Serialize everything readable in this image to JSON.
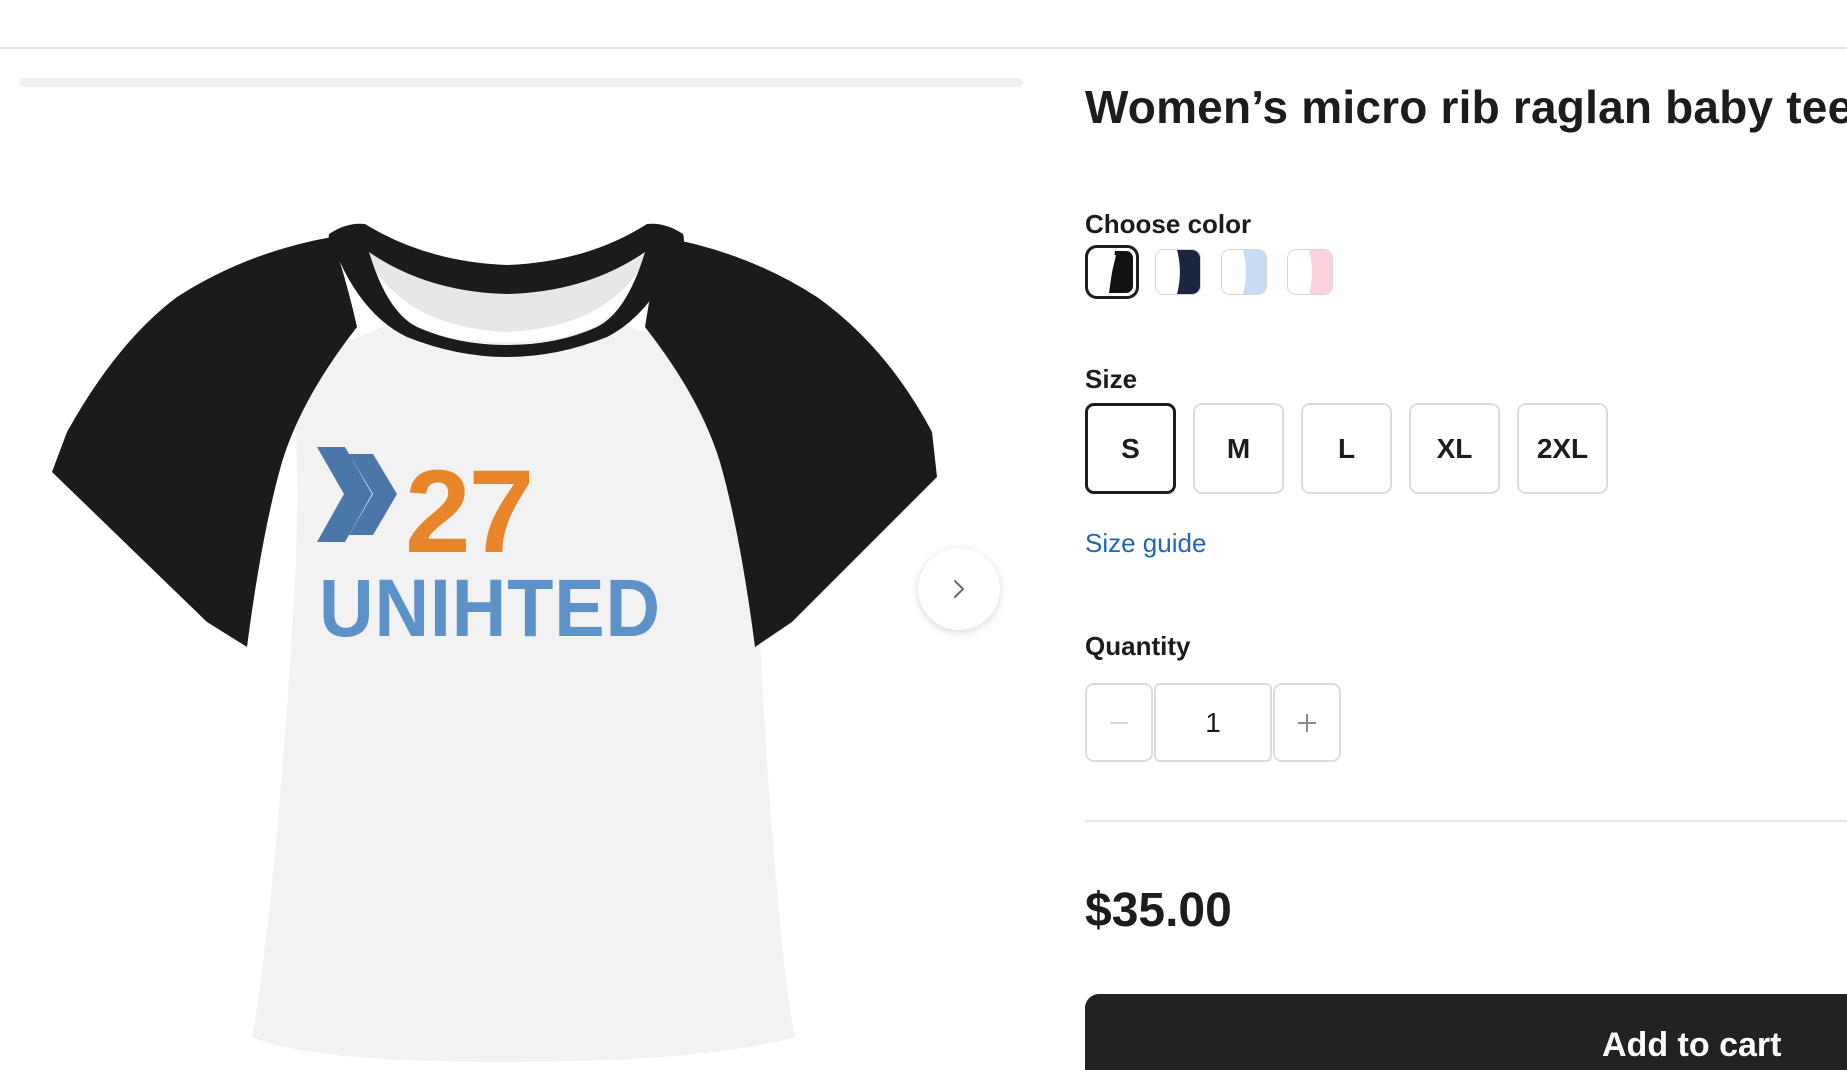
{
  "product": {
    "title": "Women’s micro rib raglan baby tee",
    "price": "$35.00",
    "image_print": {
      "number": "27",
      "word": "UNIHTED",
      "number_color": "#e8852b",
      "word_color_left": "#4f86c0",
      "word_color_right": "#6fa6d6"
    }
  },
  "color": {
    "label": "Choose color",
    "options": [
      {
        "name": "white-black",
        "primary": "#ffffff",
        "secondary": "#111111",
        "selected": true
      },
      {
        "name": "white-navy",
        "primary": "#ffffff",
        "secondary": "#1a2540",
        "selected": false
      },
      {
        "name": "white-light-blue",
        "primary": "#ffffff",
        "secondary": "#c7dcf3",
        "selected": false
      },
      {
        "name": "white-pink",
        "primary": "#ffffff",
        "secondary": "#fcd3dc",
        "selected": false
      }
    ]
  },
  "size": {
    "label": "Size",
    "options": [
      "S",
      "M",
      "L",
      "XL",
      "2XL"
    ],
    "selected": "S",
    "guide_label": "Size guide"
  },
  "quantity": {
    "label": "Quantity",
    "value": "1"
  },
  "cart": {
    "button_label": "Add to cart"
  },
  "colors": {
    "text": "#1c1c1c",
    "link": "#2166b8",
    "border": "#dcdcdc",
    "button_bg": "#222222"
  },
  "icons": {
    "next": "chevron-right-icon",
    "decrement": "minus-icon",
    "increment": "plus-icon"
  }
}
